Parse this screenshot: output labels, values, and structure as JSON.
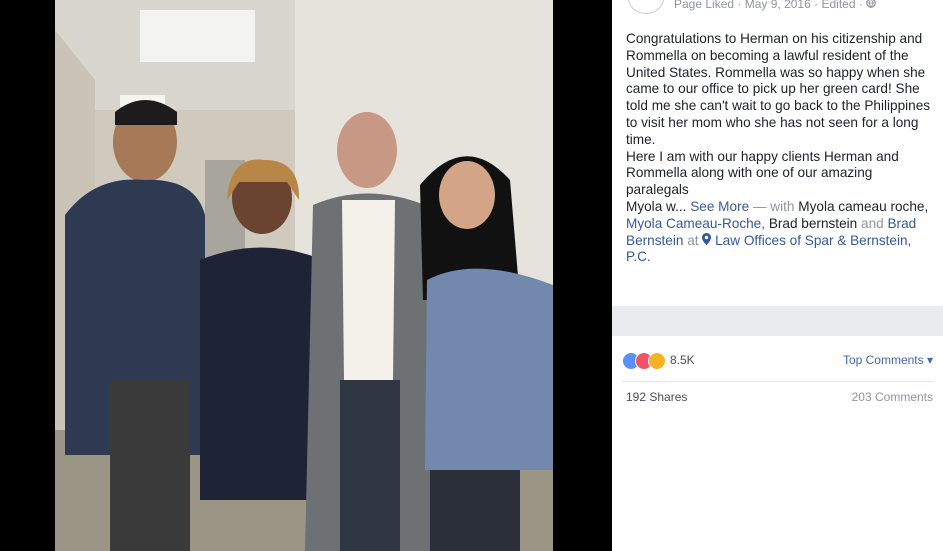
{
  "photo": {
    "description_icon": "photo-of-four-people"
  },
  "post": {
    "page_liked": "Page Liked",
    "date": "May 9, 2016",
    "edited": "Edited",
    "sep1": "·",
    "sep2": "·",
    "sep3": "·",
    "lines": [
      "Congratulations to Herman on his citizenship and",
      "Rommella on becoming a lawful resident of the",
      "United States. Rommella was so happy when she",
      "came to our office to pick up her green card! She",
      "told me she can't wait to go back to the Philippines",
      "to visit her mom who she has not seen for a long",
      "time.",
      "Here I am with our happy clients Herman and",
      "Rommella along with one of our amazing paralegals"
    ],
    "last_prefix": "Myola w...",
    "see_more": "See More",
    "dash_with": "— with",
    "tag1": "Myola cameau roche,",
    "tag2": "Myola Cameau-Roche,",
    "tag3": "Brad bernstein",
    "and": "and",
    "tag4": "Brad",
    "tag4b": "Bernstein",
    "at": "at",
    "location": "Law Offices of Spar & Bernstein, P.C."
  },
  "reactions": {
    "count": "8.5K",
    "top_comments": "Top Comments ▾"
  },
  "footer": {
    "shares": "192 Shares",
    "comments": "203 Comments"
  }
}
